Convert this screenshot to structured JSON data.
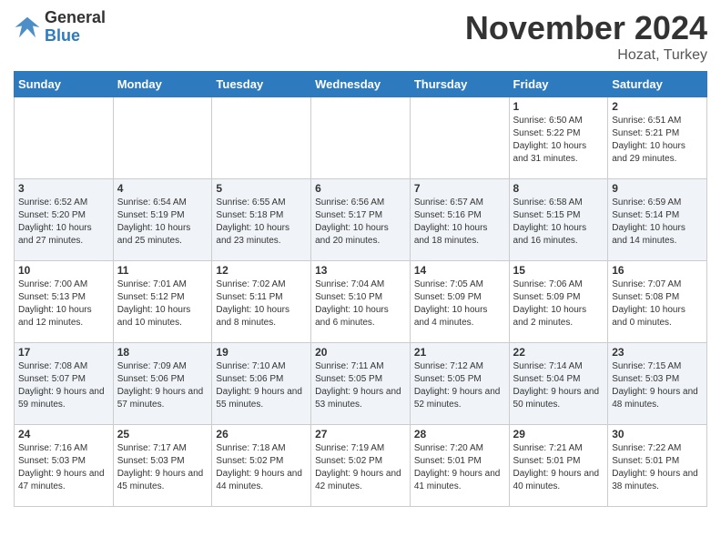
{
  "header": {
    "logo_line1": "General",
    "logo_line2": "Blue",
    "title": "November 2024",
    "subtitle": "Hozat, Turkey"
  },
  "days_of_week": [
    "Sunday",
    "Monday",
    "Tuesday",
    "Wednesday",
    "Thursday",
    "Friday",
    "Saturday"
  ],
  "weeks": [
    [
      {
        "day": "",
        "info": ""
      },
      {
        "day": "",
        "info": ""
      },
      {
        "day": "",
        "info": ""
      },
      {
        "day": "",
        "info": ""
      },
      {
        "day": "",
        "info": ""
      },
      {
        "day": "1",
        "info": "Sunrise: 6:50 AM\nSunset: 5:22 PM\nDaylight: 10 hours and 31 minutes."
      },
      {
        "day": "2",
        "info": "Sunrise: 6:51 AM\nSunset: 5:21 PM\nDaylight: 10 hours and 29 minutes."
      }
    ],
    [
      {
        "day": "3",
        "info": "Sunrise: 6:52 AM\nSunset: 5:20 PM\nDaylight: 10 hours and 27 minutes."
      },
      {
        "day": "4",
        "info": "Sunrise: 6:54 AM\nSunset: 5:19 PM\nDaylight: 10 hours and 25 minutes."
      },
      {
        "day": "5",
        "info": "Sunrise: 6:55 AM\nSunset: 5:18 PM\nDaylight: 10 hours and 23 minutes."
      },
      {
        "day": "6",
        "info": "Sunrise: 6:56 AM\nSunset: 5:17 PM\nDaylight: 10 hours and 20 minutes."
      },
      {
        "day": "7",
        "info": "Sunrise: 6:57 AM\nSunset: 5:16 PM\nDaylight: 10 hours and 18 minutes."
      },
      {
        "day": "8",
        "info": "Sunrise: 6:58 AM\nSunset: 5:15 PM\nDaylight: 10 hours and 16 minutes."
      },
      {
        "day": "9",
        "info": "Sunrise: 6:59 AM\nSunset: 5:14 PM\nDaylight: 10 hours and 14 minutes."
      }
    ],
    [
      {
        "day": "10",
        "info": "Sunrise: 7:00 AM\nSunset: 5:13 PM\nDaylight: 10 hours and 12 minutes."
      },
      {
        "day": "11",
        "info": "Sunrise: 7:01 AM\nSunset: 5:12 PM\nDaylight: 10 hours and 10 minutes."
      },
      {
        "day": "12",
        "info": "Sunrise: 7:02 AM\nSunset: 5:11 PM\nDaylight: 10 hours and 8 minutes."
      },
      {
        "day": "13",
        "info": "Sunrise: 7:04 AM\nSunset: 5:10 PM\nDaylight: 10 hours and 6 minutes."
      },
      {
        "day": "14",
        "info": "Sunrise: 7:05 AM\nSunset: 5:09 PM\nDaylight: 10 hours and 4 minutes."
      },
      {
        "day": "15",
        "info": "Sunrise: 7:06 AM\nSunset: 5:09 PM\nDaylight: 10 hours and 2 minutes."
      },
      {
        "day": "16",
        "info": "Sunrise: 7:07 AM\nSunset: 5:08 PM\nDaylight: 10 hours and 0 minutes."
      }
    ],
    [
      {
        "day": "17",
        "info": "Sunrise: 7:08 AM\nSunset: 5:07 PM\nDaylight: 9 hours and 59 minutes."
      },
      {
        "day": "18",
        "info": "Sunrise: 7:09 AM\nSunset: 5:06 PM\nDaylight: 9 hours and 57 minutes."
      },
      {
        "day": "19",
        "info": "Sunrise: 7:10 AM\nSunset: 5:06 PM\nDaylight: 9 hours and 55 minutes."
      },
      {
        "day": "20",
        "info": "Sunrise: 7:11 AM\nSunset: 5:05 PM\nDaylight: 9 hours and 53 minutes."
      },
      {
        "day": "21",
        "info": "Sunrise: 7:12 AM\nSunset: 5:05 PM\nDaylight: 9 hours and 52 minutes."
      },
      {
        "day": "22",
        "info": "Sunrise: 7:14 AM\nSunset: 5:04 PM\nDaylight: 9 hours and 50 minutes."
      },
      {
        "day": "23",
        "info": "Sunrise: 7:15 AM\nSunset: 5:03 PM\nDaylight: 9 hours and 48 minutes."
      }
    ],
    [
      {
        "day": "24",
        "info": "Sunrise: 7:16 AM\nSunset: 5:03 PM\nDaylight: 9 hours and 47 minutes."
      },
      {
        "day": "25",
        "info": "Sunrise: 7:17 AM\nSunset: 5:03 PM\nDaylight: 9 hours and 45 minutes."
      },
      {
        "day": "26",
        "info": "Sunrise: 7:18 AM\nSunset: 5:02 PM\nDaylight: 9 hours and 44 minutes."
      },
      {
        "day": "27",
        "info": "Sunrise: 7:19 AM\nSunset: 5:02 PM\nDaylight: 9 hours and 42 minutes."
      },
      {
        "day": "28",
        "info": "Sunrise: 7:20 AM\nSunset: 5:01 PM\nDaylight: 9 hours and 41 minutes."
      },
      {
        "day": "29",
        "info": "Sunrise: 7:21 AM\nSunset: 5:01 PM\nDaylight: 9 hours and 40 minutes."
      },
      {
        "day": "30",
        "info": "Sunrise: 7:22 AM\nSunset: 5:01 PM\nDaylight: 9 hours and 38 minutes."
      }
    ]
  ]
}
